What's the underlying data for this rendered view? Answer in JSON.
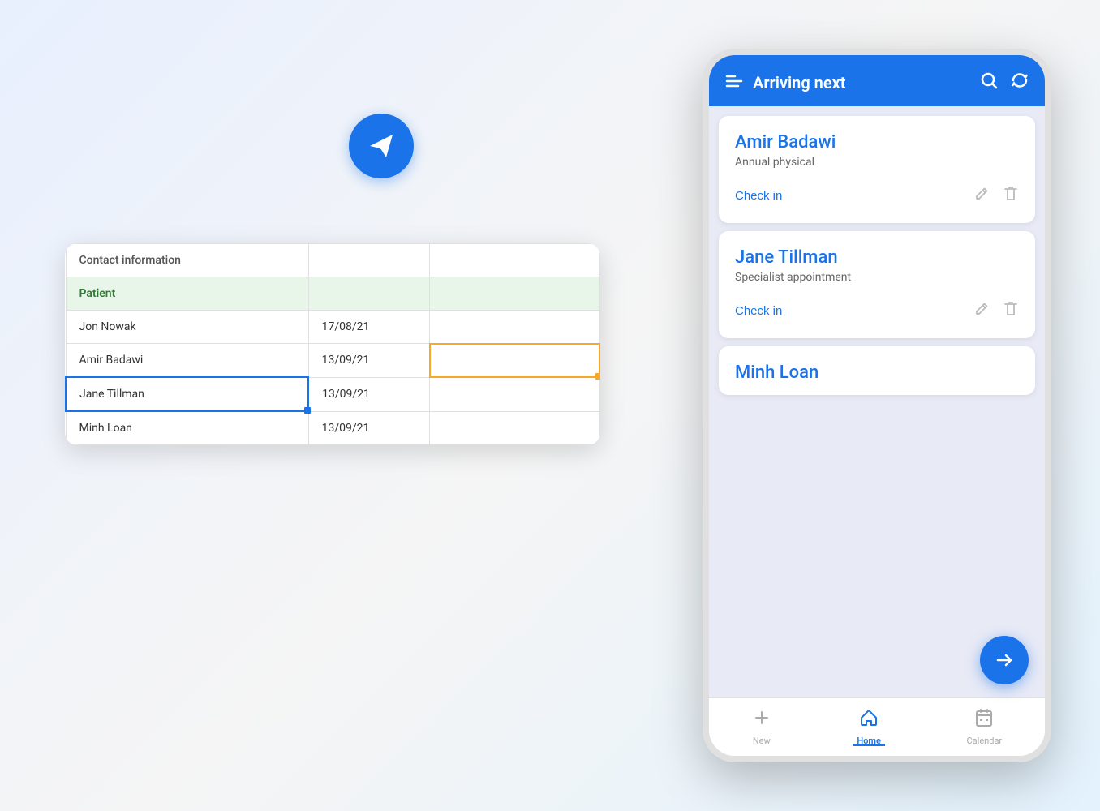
{
  "app": {
    "title": "Arriving next",
    "paper_plane_icon": "✈"
  },
  "spreadsheet": {
    "header": "Contact information",
    "section": "Patient",
    "rows": [
      {
        "name": "Jon Nowak",
        "date": "17/08/21",
        "extra": ""
      },
      {
        "name": "Amir Badawi",
        "date": "13/09/21",
        "extra": ""
      },
      {
        "name": "Jane Tillman",
        "date": "13/09/21",
        "extra": "",
        "selected": true
      },
      {
        "name": "Minh Loan",
        "date": "13/09/21",
        "extra": ""
      }
    ]
  },
  "phone": {
    "header": {
      "title": "Arriving next",
      "search_icon": "🔍",
      "refresh_icon": "↻"
    },
    "patients": [
      {
        "name": "Amir Badawi",
        "appointment": "Annual physical",
        "check_in_label": "Check in"
      },
      {
        "name": "Jane Tillman",
        "appointment": "Specialist appointment",
        "check_in_label": "Check in"
      },
      {
        "name": "Minh Loan",
        "appointment": "",
        "check_in_label": ""
      }
    ],
    "nav": {
      "new_label": "New",
      "home_label": "Home",
      "calendar_label": "Calendar"
    }
  }
}
